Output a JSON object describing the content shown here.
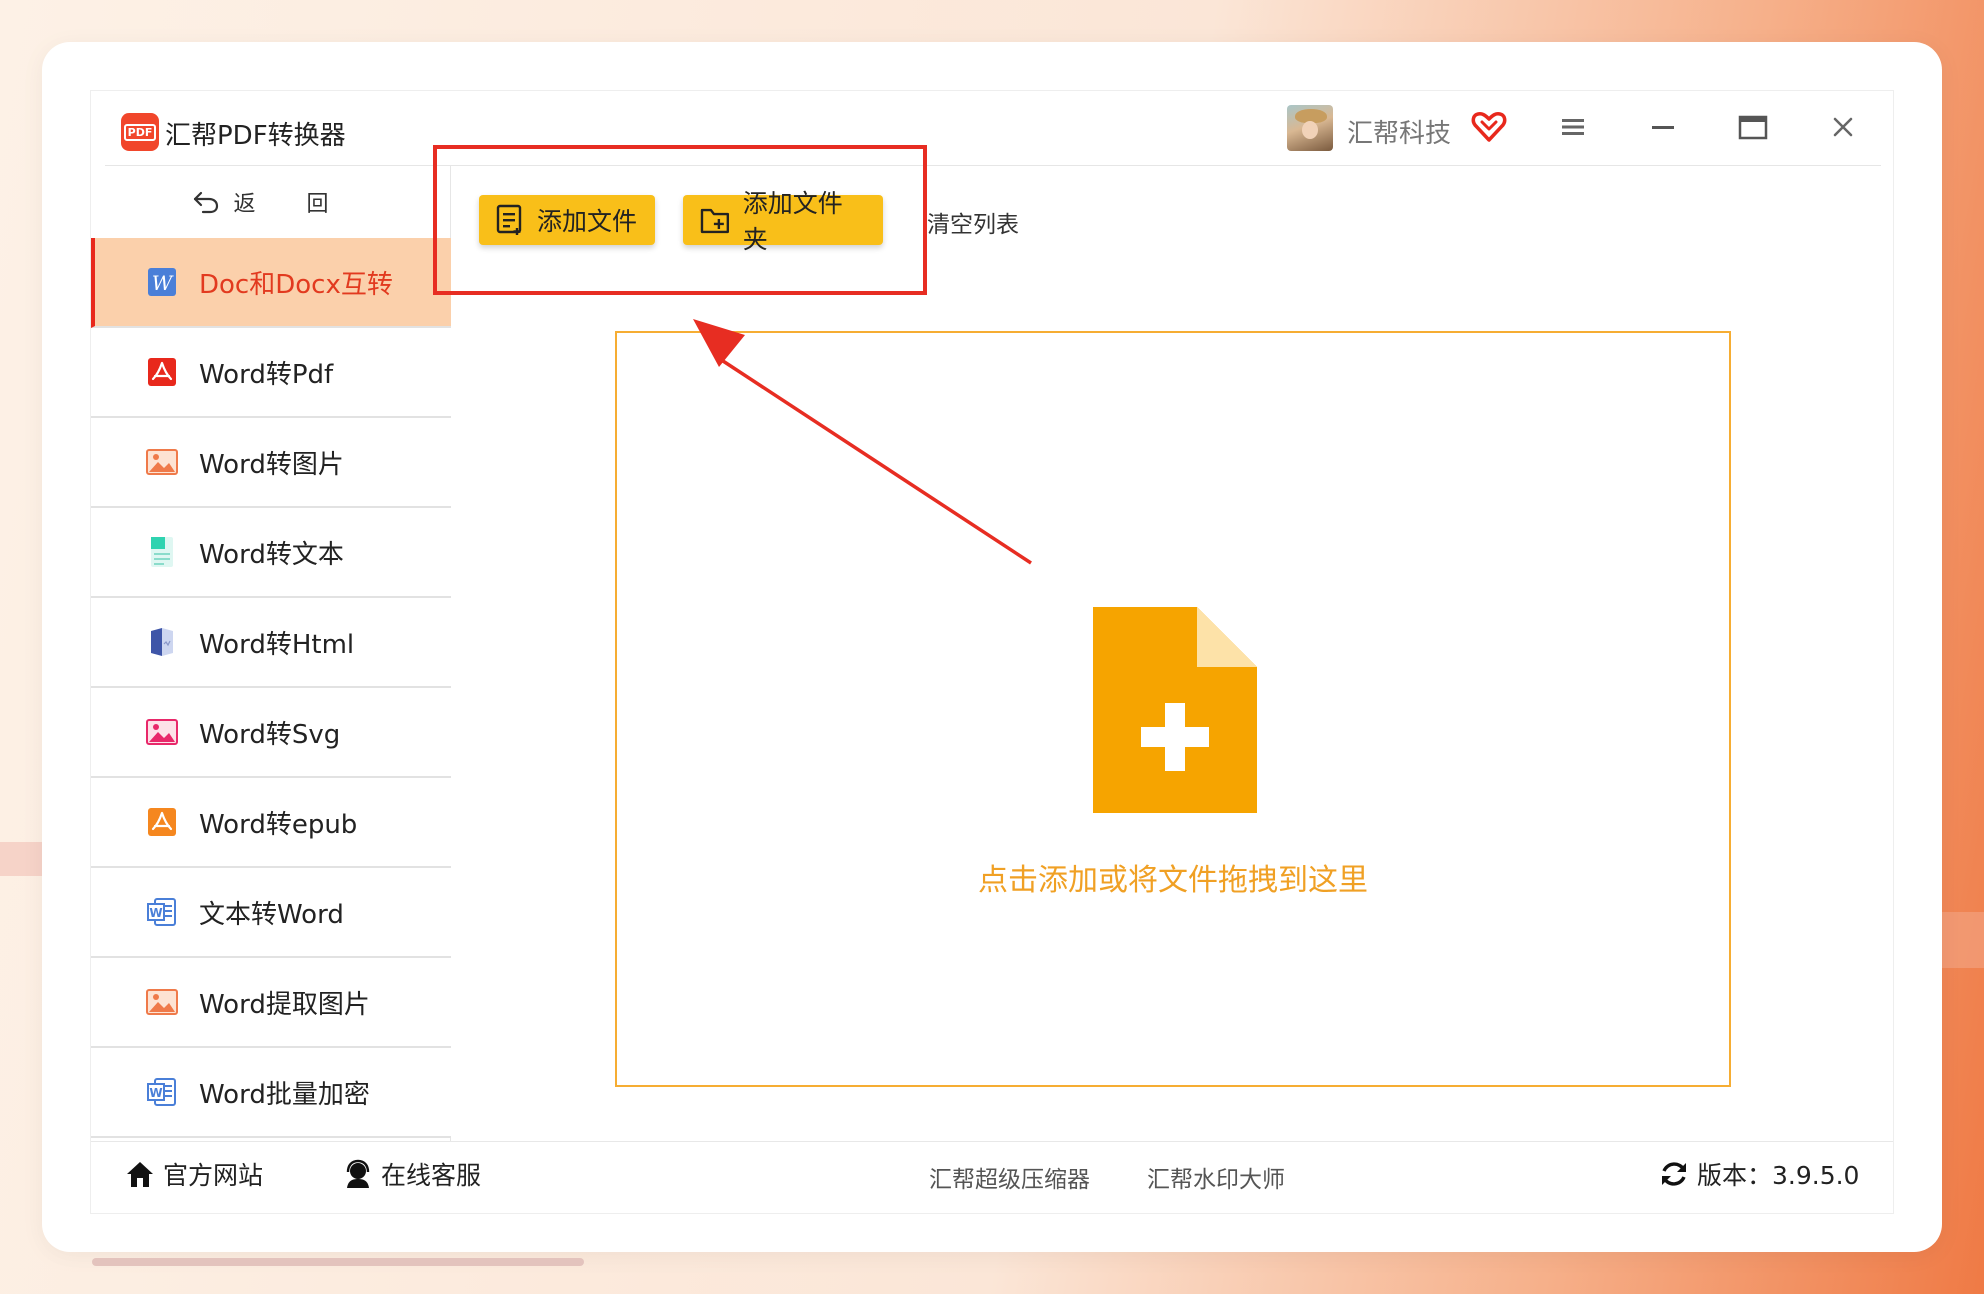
{
  "app": {
    "title": "汇帮PDF转换器",
    "logo_text": "PDF",
    "user_name": "汇帮科技"
  },
  "sidebar": {
    "back_label": "返 回",
    "items": [
      {
        "label": "Doc和Docx互转",
        "icon": "word-icon",
        "active": true
      },
      {
        "label": "Word转Pdf",
        "icon": "pdf-icon"
      },
      {
        "label": "Word转图片",
        "icon": "image-icon"
      },
      {
        "label": "Word转文本",
        "icon": "text-doc-icon"
      },
      {
        "label": "Word转Html",
        "icon": "html-book-icon"
      },
      {
        "label": "Word转Svg",
        "icon": "svg-image-icon"
      },
      {
        "label": "Word转epub",
        "icon": "epub-icon"
      },
      {
        "label": "文本转Word",
        "icon": "word-doc-icon"
      },
      {
        "label": "Word提取图片",
        "icon": "image-icon"
      },
      {
        "label": "Word批量加密",
        "icon": "word-doc-icon"
      }
    ]
  },
  "toolbar": {
    "add_file": "添加文件",
    "add_folder": "添加文件夹",
    "clear_list": "清空列表"
  },
  "dropzone": {
    "hint": "点击添加或将文件拖拽到这里"
  },
  "footer": {
    "official_site": "官方网站",
    "online_service": "在线客服",
    "compressor": "汇帮超级压缩器",
    "watermark": "汇帮水印大师",
    "version": "版本：3.9.5.0"
  },
  "colors": {
    "accent": "#f9bf19",
    "active_bg": "#fbd0ab",
    "active_text": "#e23a1f",
    "annotation": "#e72d22",
    "drop_orange": "#f6a400"
  }
}
